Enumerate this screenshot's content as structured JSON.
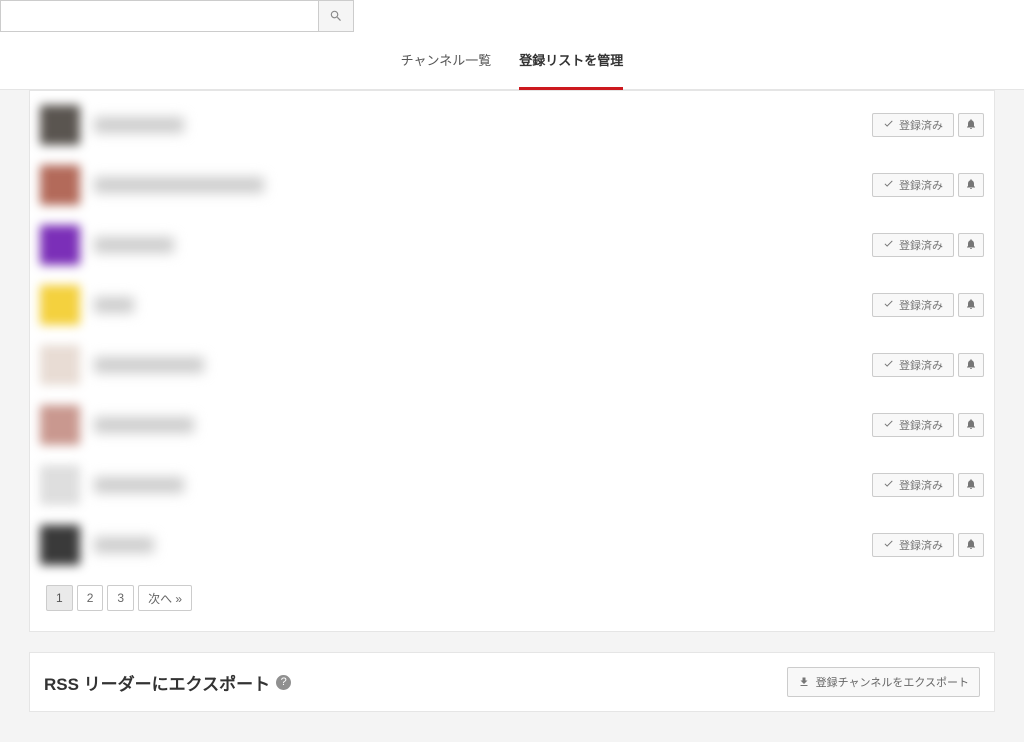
{
  "search": {
    "placeholder": ""
  },
  "tabs": {
    "channel_list": "チャンネル一覧",
    "manage_subs": "登録リストを管理"
  },
  "subscribed_label": "登録済み",
  "channels": [
    {
      "avatar_color": "#5a5550",
      "name_width": 90
    },
    {
      "avatar_color": "#b36a5a",
      "name_width": 170
    },
    {
      "avatar_color": "#7b2fb8",
      "name_width": 80
    },
    {
      "avatar_color": "#f4d13e",
      "name_width": 40
    },
    {
      "avatar_color": "#e8dcd4",
      "name_width": 110
    },
    {
      "avatar_color": "#c9988f",
      "name_width": 100
    },
    {
      "avatar_color": "#dedede",
      "name_width": 90
    },
    {
      "avatar_color": "#3a3a3a",
      "name_width": 60
    }
  ],
  "pagination": {
    "p1": "1",
    "p2": "2",
    "p3": "3",
    "next": "次へ »"
  },
  "export": {
    "title": "RSS リーダーにエクスポート",
    "button": "登録チャンネルをエクスポート"
  }
}
